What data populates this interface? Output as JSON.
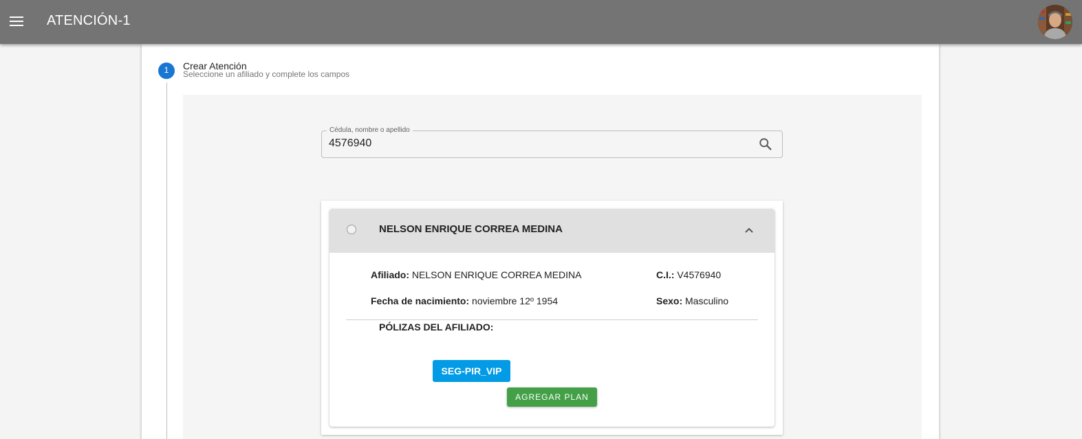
{
  "appbar": {
    "title": "ATENCIÓN-1",
    "menu_icon": "menu-icon",
    "avatar": "user-avatar"
  },
  "stepper": {
    "number": "1",
    "title": "Crear Atención",
    "subtitle": "Seleccione un afiliado y complete los campos",
    "accent": "#1976d2"
  },
  "search": {
    "label": "Cédula, nombre o apellido",
    "value": "4576940",
    "icon": "search-icon"
  },
  "result": {
    "name": "NELSON ENRIQUE CORREA MEDINA",
    "afiliado_label": "Afiliado:",
    "afiliado_value": "NELSON ENRIQUE CORREA MEDINA",
    "ci_label": "C.I.:",
    "ci_value": "V4576940",
    "fecha_label": "Fecha de nacimiento:",
    "fecha_value": "noviembre 12º 1954",
    "sexo_label": "Sexo:",
    "sexo_value": "Masculino",
    "polizas_title": "PÓLIZAS DEL AFILIADO:",
    "policies": [
      "SEG-PIR_VIP"
    ],
    "add_plan_label": "AGREGAR PLAN",
    "expanded": true
  },
  "colors": {
    "appbar": "#747474",
    "policy_chip": "#039be5",
    "add_plan": "#43a047"
  }
}
